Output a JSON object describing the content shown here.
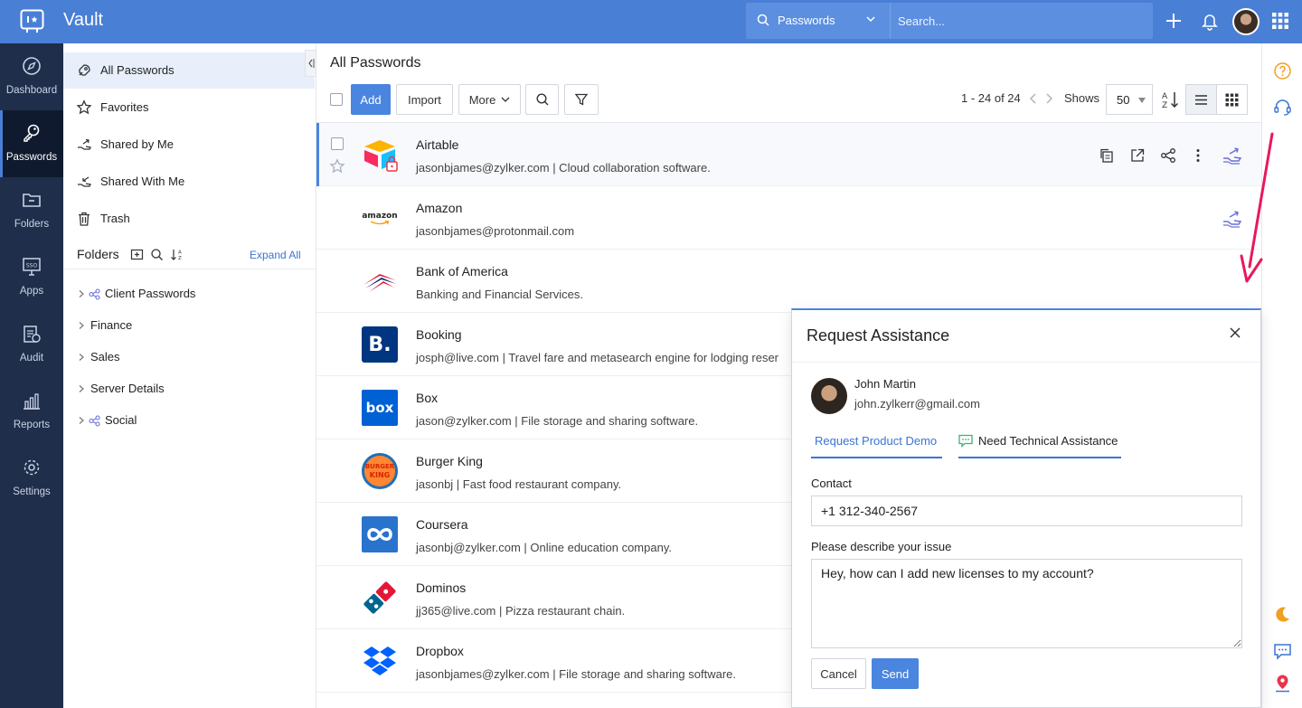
{
  "app": {
    "title": "Vault"
  },
  "topbar": {
    "scope": "Passwords",
    "search_placeholder": "Search..."
  },
  "rail": [
    {
      "label": "Dashboard",
      "icon": "compass-icon"
    },
    {
      "label": "Passwords",
      "icon": "key-icon",
      "active": true
    },
    {
      "label": "Folders",
      "icon": "folder-icon"
    },
    {
      "label": "Apps",
      "icon": "sso-icon"
    },
    {
      "label": "Audit",
      "icon": "clipboard-icon"
    },
    {
      "label": "Reports",
      "icon": "bar-chart-icon"
    },
    {
      "label": "Settings",
      "icon": "gear-icon"
    }
  ],
  "sidebar": {
    "items": [
      {
        "label": "All Passwords",
        "icon": "rocket-icon",
        "active": true
      },
      {
        "label": "Favorites",
        "icon": "star-icon"
      },
      {
        "label": "Shared by Me",
        "icon": "share-out-icon"
      },
      {
        "label": "Shared With Me",
        "icon": "share-in-icon"
      },
      {
        "label": "Trash",
        "icon": "trash-icon"
      }
    ],
    "folders_title": "Folders",
    "expand_all": "Expand All",
    "folders": [
      {
        "label": "Client Passwords",
        "shared": true
      },
      {
        "label": "Finance",
        "shared": false
      },
      {
        "label": "Sales",
        "shared": false
      },
      {
        "label": "Server Details",
        "shared": false
      },
      {
        "label": "Social",
        "shared": true
      }
    ]
  },
  "main": {
    "title": "All Passwords",
    "toolbar": {
      "add": "Add",
      "import": "Import",
      "more": "More"
    },
    "pager": {
      "range": "1 - 24 of 24",
      "shows_label": "Shows",
      "per_page": "50"
    },
    "rows": [
      {
        "name": "Airtable",
        "desc": "jasonbjames@zylker.com | Cloud collaboration software."
      },
      {
        "name": "Amazon",
        "desc": "jasonbjames@protonmail.com"
      },
      {
        "name": "Bank of America",
        "desc": "Banking and Financial Services."
      },
      {
        "name": "Booking",
        "desc": "josph@live.com | Travel fare and metasearch engine for lodging reser"
      },
      {
        "name": "Box",
        "desc": "jason@zylker.com | File storage and sharing software."
      },
      {
        "name": "Burger King",
        "desc": "jasonbj | Fast food restaurant company."
      },
      {
        "name": "Coursera",
        "desc": "jasonbj@zylker.com | Online education company."
      },
      {
        "name": "Dominos",
        "desc": "jj365@live.com | Pizza restaurant chain."
      },
      {
        "name": "Dropbox",
        "desc": "jasonbjames@zylker.com | File storage and sharing software."
      }
    ],
    "logos": {
      "amazon": "amazon",
      "booking": "B.",
      "box": "box",
      "burger_king_1": "BURGER",
      "burger_king_2": "KING"
    }
  },
  "modal": {
    "title": "Request Assistance",
    "user_name": "John Martin",
    "user_email": "john.zylkerr@gmail.com",
    "tab_demo": "Request Product Demo",
    "tab_tech": "Need Technical Assistance",
    "contact_label": "Contact",
    "contact_value": "+1 312-340-2567",
    "issue_label": "Please describe your issue",
    "issue_value": "Hey, how can I add new licenses to my account?",
    "cancel": "Cancel",
    "send": "Send"
  },
  "colors": {
    "topbar": "#4a7fd6",
    "rail": "#1f2e4a",
    "accent": "#4a85df",
    "arrow": "#e8195a"
  }
}
